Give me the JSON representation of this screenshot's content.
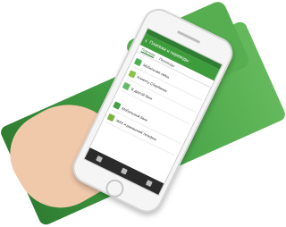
{
  "headline": "",
  "screen": {
    "app_title": "Платежи и переводы",
    "tabs": [
      "Платежи",
      "Переводы"
    ],
    "active_tab": "Платежи",
    "rows_top": [
      {
        "label": "Мобильная связь",
        "icon": "phone-icon"
      },
      {
        "label": "Клиенту Сбербанка",
        "icon": "person-icon"
      },
      {
        "label": "В другой банк",
        "icon": "bank-icon"
      }
    ],
    "section_label": "",
    "rows_bottom": [
      {
        "label": "Мобильный банк",
        "icon": "sms-icon"
      },
      {
        "label": "ЖКХ и домашний телефон",
        "icon": "home-icon"
      }
    ]
  },
  "colors": {
    "green": "#3f9c3c",
    "green_dark": "#2e7d32",
    "background_band": "#45a245",
    "skin": "#f0c8aa"
  }
}
